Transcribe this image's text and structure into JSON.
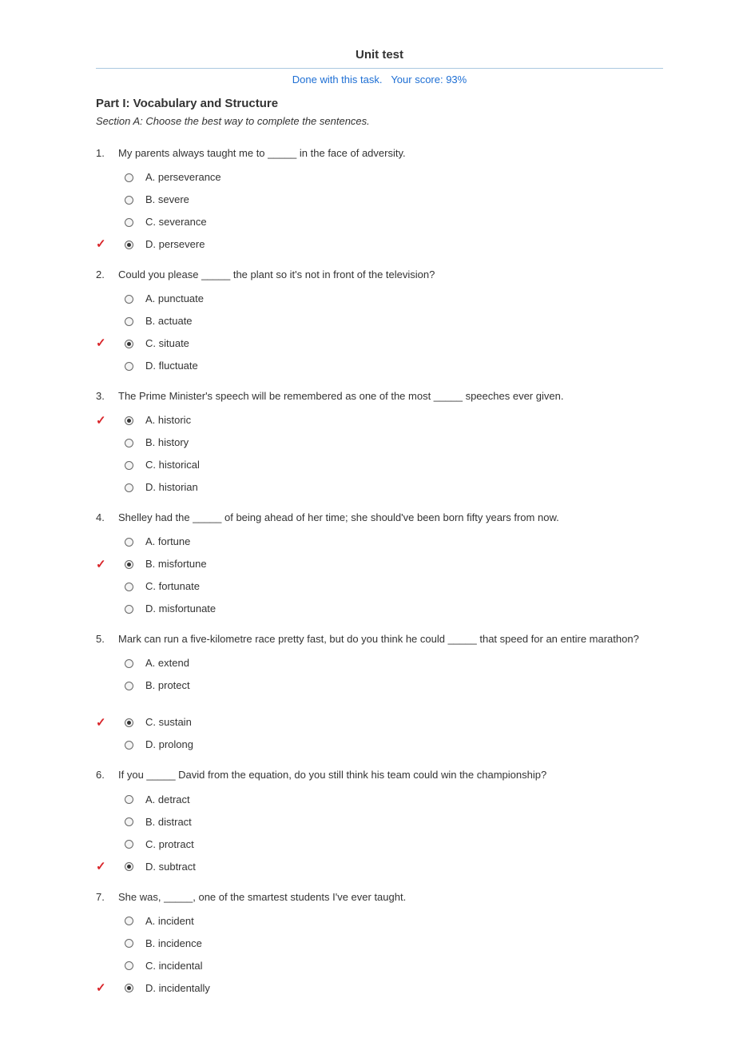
{
  "title": "Unit test",
  "status_done": "Done with this task.",
  "status_score": "Your score: 93%",
  "part_title": "Part I: Vocabulary and Structure",
  "section_desc": "Section A: Choose the best way to complete the sentences.",
  "questions": [
    {
      "num": "1.",
      "stem": "My parents always taught me to _____ in the face of adversity.",
      "options": [
        {
          "text": "A. perseverance",
          "selected": false,
          "correct": false
        },
        {
          "text": "B. severe",
          "selected": false,
          "correct": false
        },
        {
          "text": "C. severance",
          "selected": false,
          "correct": false
        },
        {
          "text": "D. persevere",
          "selected": true,
          "correct": true
        }
      ],
      "gap_after": false
    },
    {
      "num": "2.",
      "stem": "Could you please _____ the plant so it's not in front of the television?",
      "options": [
        {
          "text": "A. punctuate",
          "selected": false,
          "correct": false
        },
        {
          "text": "B. actuate",
          "selected": false,
          "correct": false
        },
        {
          "text": "C. situate",
          "selected": true,
          "correct": true
        },
        {
          "text": "D. fluctuate",
          "selected": false,
          "correct": false
        }
      ],
      "gap_after": false
    },
    {
      "num": "3.",
      "stem": "The Prime Minister's speech will be remembered as one of the most _____ speeches ever given.",
      "options": [
        {
          "text": "A. historic",
          "selected": true,
          "correct": true
        },
        {
          "text": "B. history",
          "selected": false,
          "correct": false
        },
        {
          "text": "C. historical",
          "selected": false,
          "correct": false
        },
        {
          "text": "D. historian",
          "selected": false,
          "correct": false
        }
      ],
      "gap_after": false
    },
    {
      "num": "4.",
      "stem": "Shelley had the _____ of being ahead of her time; she should've been born fifty years from now.",
      "options": [
        {
          "text": "A. fortune",
          "selected": false,
          "correct": false
        },
        {
          "text": "B. misfortune",
          "selected": true,
          "correct": true
        },
        {
          "text": "C. fortunate",
          "selected": false,
          "correct": false
        },
        {
          "text": "D. misfortunate",
          "selected": false,
          "correct": false
        }
      ],
      "gap_after": false
    },
    {
      "num": "5.",
      "stem": "Mark can run a five-kilometre race pretty fast, but do you think he could _____ that speed for an entire marathon?",
      "options": [
        {
          "text": "A. extend",
          "selected": false,
          "correct": false
        },
        {
          "text": "B. protect",
          "selected": false,
          "correct": false
        }
      ],
      "gap_after": false,
      "gap_mid": true,
      "options2": [
        {
          "text": "C. sustain",
          "selected": true,
          "correct": true
        },
        {
          "text": "D. prolong",
          "selected": false,
          "correct": false
        }
      ]
    },
    {
      "num": "6.",
      "stem": "If you _____ David from the equation, do you still think his team could win the championship?",
      "options": [
        {
          "text": "A. detract",
          "selected": false,
          "correct": false
        },
        {
          "text": "B. distract",
          "selected": false,
          "correct": false
        },
        {
          "text": "C. protract",
          "selected": false,
          "correct": false
        },
        {
          "text": "D. subtract",
          "selected": true,
          "correct": true
        }
      ],
      "gap_after": false
    },
    {
      "num": "7.",
      "stem": "She was, _____, one of the smartest students I've ever taught.",
      "options": [
        {
          "text": "A. incident",
          "selected": false,
          "correct": false
        },
        {
          "text": "B. incidence",
          "selected": false,
          "correct": false
        },
        {
          "text": "C. incidental",
          "selected": false,
          "correct": false
        },
        {
          "text": "D. incidentally",
          "selected": true,
          "correct": true
        }
      ],
      "gap_after": false
    }
  ]
}
